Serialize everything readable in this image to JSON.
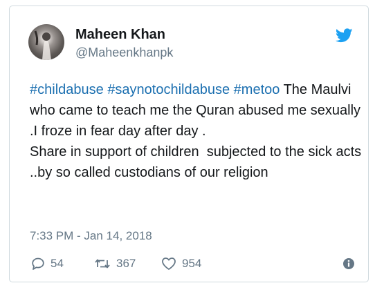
{
  "tweet": {
    "author_name": "Maheen Khan",
    "author_handle": "@Maheenkhanpk",
    "hashtags": [
      "#childabuse",
      "#saynotochildabuse",
      "#metoo"
    ],
    "text_after_tags": " The Maulvi who came to teach me the Quran abused me sexually .I froze in fear day after day .\nShare in support of children  subjected to the sick acts  ..by so called custodians of our religion",
    "timestamp": "7:33 PM - Jan 14, 2018"
  },
  "actions": {
    "replies": "54",
    "retweets": "367",
    "likes": "954"
  },
  "icons": {
    "brand": "twitter-bird-icon",
    "reply": "reply-icon",
    "retweet": "retweet-icon",
    "like": "heart-icon",
    "info": "info-icon"
  },
  "colors": {
    "brand": "#1da1f2",
    "hashtag": "#1b6fb0",
    "text": "#14171a",
    "muted": "#657786",
    "border": "#cfd9de"
  }
}
